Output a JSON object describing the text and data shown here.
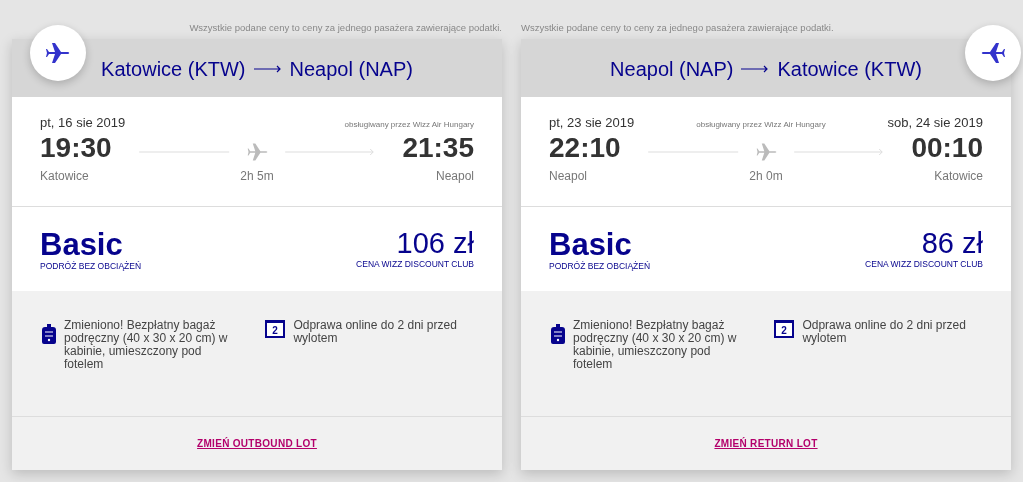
{
  "flights": [
    {
      "kind": "outbound",
      "note": "Wszystkie podane ceny to ceny za jednego pasażera zawierające podatki.",
      "origin": "Katowice (KTW)",
      "destination": "Neapol (NAP)",
      "departure_date": "pt, 16 sie 2019",
      "operator": "obsługiwany przez Wizz Air Hungary",
      "departure_time": "19:30",
      "duration": "2h 5m",
      "arrival_time": "21:35",
      "departure_city": "Katowice",
      "arrival_city": "Neapol",
      "fare": "Basic",
      "fare_subtitle": "PODRÓŻ BEZ OBCIĄŻEŃ",
      "price": "106 zł",
      "price_label": "CENA WIZZ DISCOUNT CLUB",
      "features": [
        {
          "kind": "baggage",
          "text": "Zmieniono! Bezpłatny bagaż podręczny (40 x 30 x 20 cm) w kabinie, umieszczony pod fotelem"
        },
        {
          "kind": "checkin",
          "calendar_day": "2",
          "text": "Odprawa online do 2 dni przed wylotem"
        }
      ],
      "change_link": "ZMIEŃ OUTBOUND LOT"
    },
    {
      "kind": "return",
      "note": "Wszystkie podane ceny to ceny za jednego pasażera zawierające podatki.",
      "origin": "Neapol (NAP)",
      "destination": "Katowice (KTW)",
      "departure_date": "pt, 23 sie 2019",
      "operator": "obsługiwany przez Wizz Air Hungary",
      "arrival_date": "sob, 24 sie 2019",
      "departure_time": "22:10",
      "duration": "2h 0m",
      "arrival_time": "00:10",
      "departure_city": "Neapol",
      "arrival_city": "Katowice",
      "fare": "Basic",
      "fare_subtitle": "PODRÓŻ BEZ OBCIĄŻEŃ",
      "price": "86 zł",
      "price_label": "CENA WIZZ DISCOUNT CLUB",
      "features": [
        {
          "kind": "baggage",
          "text": "Zmieniono! Bezpłatny bagaż podręczny (40 x 30 x 20 cm) w kabinie, umieszczony pod fotelem"
        },
        {
          "kind": "checkin",
          "calendar_day": "2",
          "text": "Odprawa online do 2 dni przed wylotem"
        }
      ],
      "change_link": "ZMIEŃ RETURN LOT"
    }
  ]
}
